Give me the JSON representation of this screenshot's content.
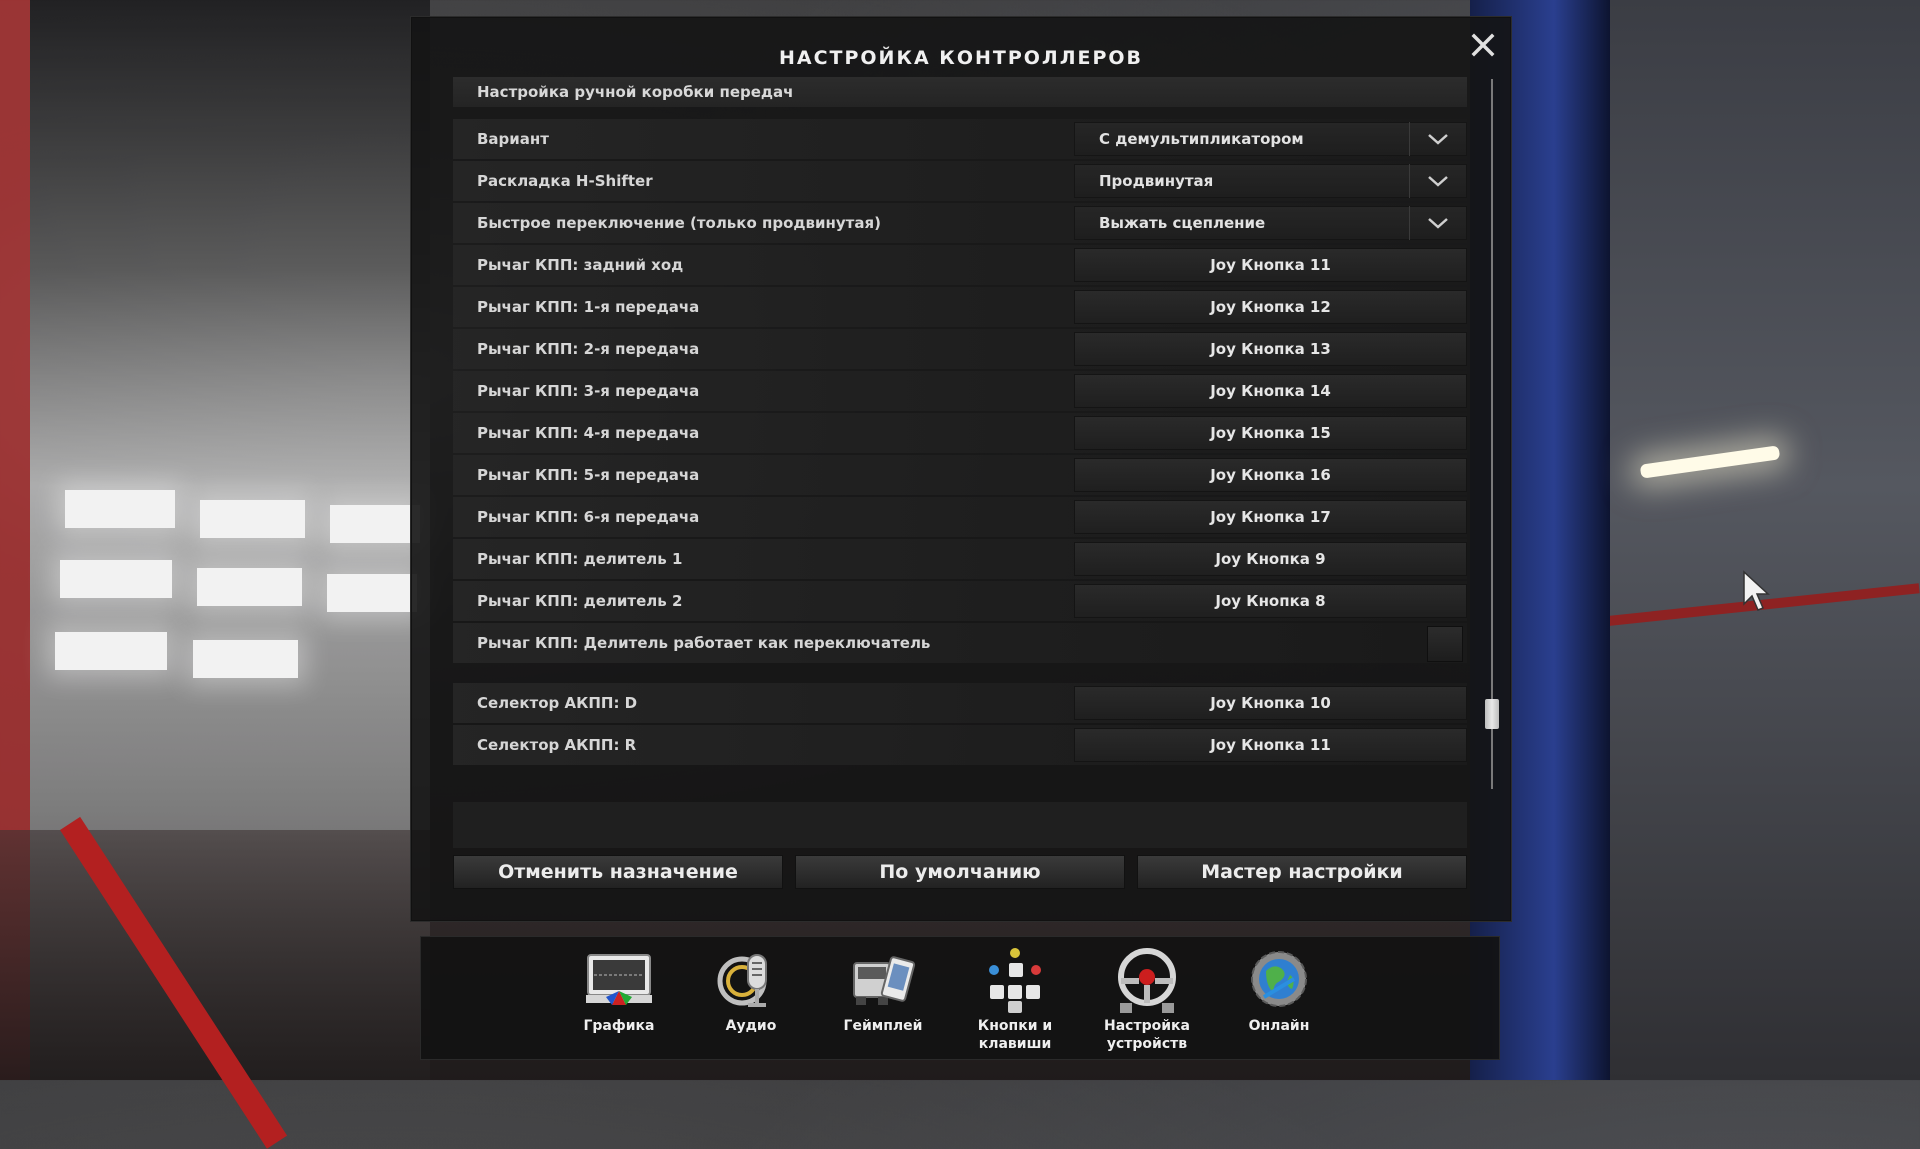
{
  "dialog": {
    "title": "НАСТРОЙКА КОНТРОЛЛЕРОВ",
    "section_header": "Настройка ручной коробки передач"
  },
  "rows": [
    {
      "label": "Вариант",
      "type": "dropdown",
      "value": "С демультипликатором"
    },
    {
      "label": "Раскладка H-Shifter",
      "type": "dropdown",
      "value": "Продвинутая"
    },
    {
      "label": "Быстрое переключение (только продвинутая)",
      "type": "dropdown",
      "value": "Выжать сцепление"
    },
    {
      "label": "Рычаг КПП: задний ход",
      "type": "binding",
      "value": "Joy Кнопка 11"
    },
    {
      "label": "Рычаг КПП: 1-я передача",
      "type": "binding",
      "value": "Joy Кнопка 12"
    },
    {
      "label": "Рычаг КПП: 2-я передача",
      "type": "binding",
      "value": "Joy Кнопка 13"
    },
    {
      "label": "Рычаг КПП: 3-я передача",
      "type": "binding",
      "value": "Joy Кнопка 14"
    },
    {
      "label": "Рычаг КПП: 4-я передача",
      "type": "binding",
      "value": "Joy Кнопка 15"
    },
    {
      "label": "Рычаг КПП: 5-я передача",
      "type": "binding",
      "value": "Joy Кнопка 16"
    },
    {
      "label": "Рычаг КПП: 6-я передача",
      "type": "binding",
      "value": "Joy Кнопка 17"
    },
    {
      "label": "Рычаг КПП: делитель 1",
      "type": "binding",
      "value": "Joy Кнопка 9"
    },
    {
      "label": "Рычаг КПП: делитель 2",
      "type": "binding",
      "value": "Joy Кнопка 8"
    },
    {
      "label": "Рычаг КПП: Делитель работает как переключатель",
      "type": "checkbox",
      "checked": false
    }
  ],
  "rows_after": [
    {
      "label": "Селектор АКПП: D",
      "type": "binding",
      "value": "Joy Кнопка 10"
    },
    {
      "label": "Селектор АКПП: R",
      "type": "binding",
      "value": "Joy Кнопка 11"
    }
  ],
  "footer": {
    "unassign_label": "Отменить назначение",
    "default_label": "По умолчанию",
    "wizard_label": "Мастер настройки"
  },
  "nav": {
    "items": [
      {
        "label": "Графика",
        "icon": "monitor-icon"
      },
      {
        "label": "Аудио",
        "icon": "microphone-icon"
      },
      {
        "label": "Геймплей",
        "icon": "truck-phone-icon"
      },
      {
        "label": "Кнопки и",
        "label2": "клавиши",
        "icon": "keys-icon"
      },
      {
        "label": "Настройка",
        "label2": "устройств",
        "icon": "steering-wheel-icon"
      },
      {
        "label": "Онлайн",
        "icon": "globe-gear-icon"
      }
    ]
  },
  "colors": {
    "panel": "#141414",
    "row": "#262626",
    "text": "#e6e6e6"
  }
}
